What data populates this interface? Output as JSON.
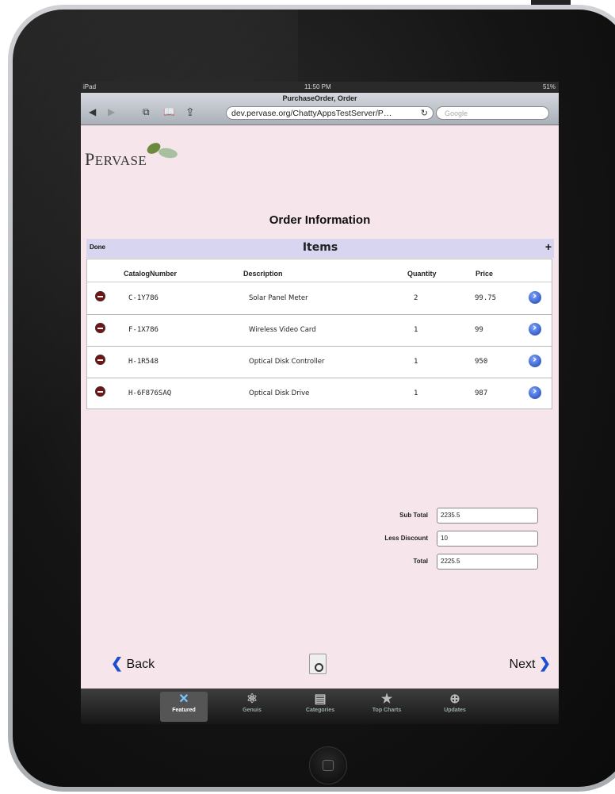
{
  "status": {
    "device": "iPad",
    "time": "11:50 PM",
    "battery": "51%"
  },
  "browser": {
    "page_title": "PurchaseOrder, Order",
    "url": "dev.pervase.org/ChattyAppsTestServer/P…",
    "search_placeholder": "Google"
  },
  "logo": {
    "first": "P",
    "rest": "ERVASE"
  },
  "order": {
    "title": "Order Information"
  },
  "items": {
    "done_label": "Done",
    "title": "Items",
    "add_label": "+",
    "headers": {
      "catalog": "CatalogNumber",
      "description": "Description",
      "quantity": "Quantity",
      "price": "Price"
    },
    "rows": [
      {
        "catalog": "C-1Y786",
        "description": "Solar Panel Meter",
        "quantity": "2",
        "price": "99.75"
      },
      {
        "catalog": "F-1X786",
        "description": "Wireless Video Card",
        "quantity": "1",
        "price": "99"
      },
      {
        "catalog": "H-1R548",
        "description": "Optical Disk Controller",
        "quantity": "1",
        "price": "950"
      },
      {
        "catalog": "H-6F876SAQ",
        "description": "Optical Disk Drive",
        "quantity": "1",
        "price": "987"
      }
    ]
  },
  "totals": {
    "subtotal_label": "Sub Total",
    "subtotal_value": "2235.5",
    "discount_label": "Less Discount",
    "discount_value": "10",
    "total_label": "Total",
    "total_value": "2225.5"
  },
  "nav": {
    "back": "Back",
    "next": "Next"
  },
  "tabs": [
    "Featured",
    "Genuis",
    "Categories",
    "Top Charts",
    "Updates"
  ]
}
